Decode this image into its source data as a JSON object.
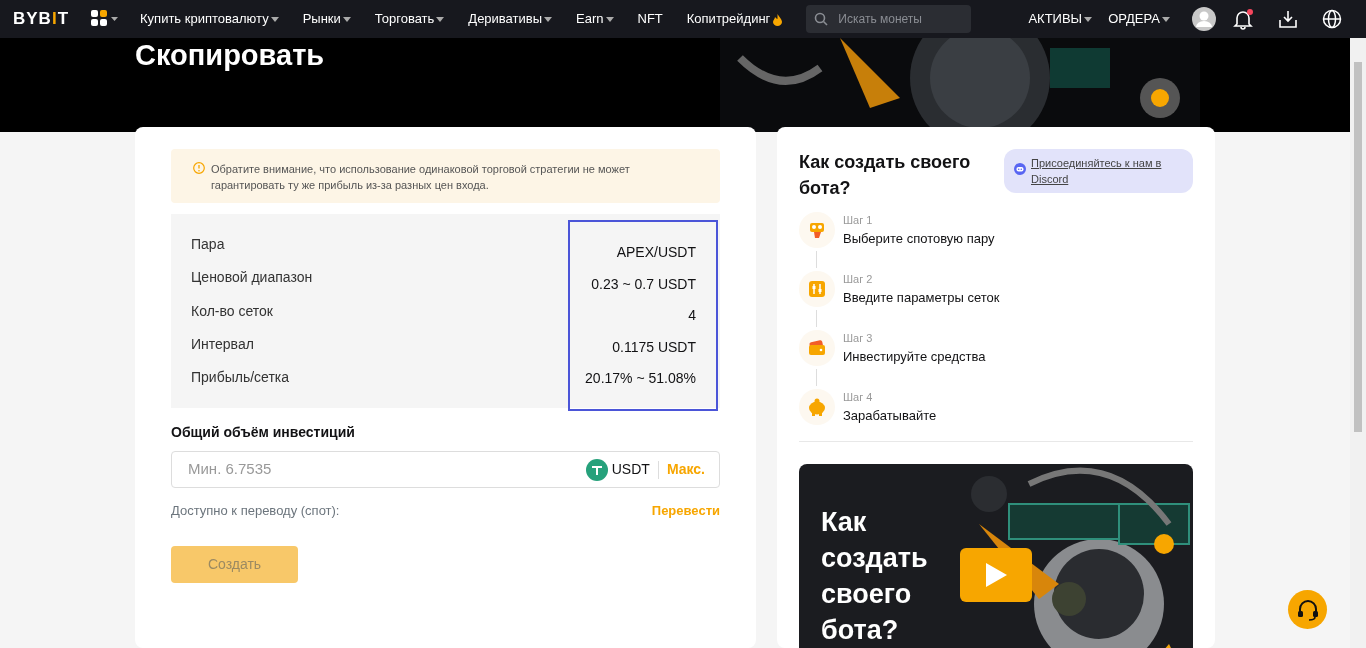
{
  "navbar": {
    "logo": {
      "head": "BYB",
      "accent": "I",
      "tail": "T"
    },
    "menu": [
      {
        "label": "Купить криптовалюту",
        "has_menu": true,
        "hot": false
      },
      {
        "label": "Рынки",
        "has_menu": true,
        "hot": false
      },
      {
        "label": "Торговать",
        "has_menu": true,
        "hot": false
      },
      {
        "label": "Деривативы",
        "has_menu": true,
        "hot": false
      },
      {
        "label": "Earn",
        "has_menu": true,
        "hot": false
      },
      {
        "label": "NFT",
        "has_menu": false,
        "hot": false
      },
      {
        "label": "Копитрейдинг",
        "has_menu": false,
        "hot": true
      }
    ],
    "search": {
      "placeholder": "Искать монеты"
    },
    "right_menu": [
      {
        "label": "АКТИВЫ",
        "has_menu": true
      },
      {
        "label": "ОРДЕРА",
        "has_menu": true
      }
    ],
    "notifications_unread": true
  },
  "page": {
    "title": "Скопировать"
  },
  "form": {
    "notice": "Обратите внимание, что использование одинаковой торговой стратегии не может гарантировать ту же прибыль из-за разных цен входа.",
    "values_highlighted": true,
    "params": [
      {
        "label": "Пара",
        "value": "APEX/USDT"
      },
      {
        "label": "Ценовой диапазон",
        "value": "0.23 ~ 0.7 USDT"
      },
      {
        "label": "Кол-во сеток",
        "value": "4"
      },
      {
        "label": "Интервал",
        "value": "0.1175 USDT"
      },
      {
        "label": "Прибыль/сетка",
        "value": "20.17% ~ 51.08%"
      }
    ],
    "investment_label": "Общий объём инвестиций",
    "investment_field": {
      "placeholder": "Мин. 6.7535",
      "currency": "USDT",
      "max": "Макс."
    },
    "available_label": "Доступно к переводу (спот):",
    "transfer_link": "Перевести",
    "create_button": {
      "label": "Создать",
      "disabled": true
    }
  },
  "guide": {
    "title": "Как создать своего бота?",
    "discord": "Присоединяйтесь к нам в Discord",
    "steps": [
      {
        "kind": "pair",
        "step": "Шаг 1",
        "text": "Выберите спотовую пару"
      },
      {
        "kind": "params",
        "step": "Шаг 2",
        "text": "Введите параметры сеток"
      },
      {
        "kind": "wallet",
        "step": "Шаг 3",
        "text": "Инвестируйте средства"
      },
      {
        "kind": "piggy",
        "step": "Шаг 4",
        "text": "Зарабатывайте"
      }
    ],
    "video": {
      "caption": "Как создать своего бота?"
    }
  }
}
